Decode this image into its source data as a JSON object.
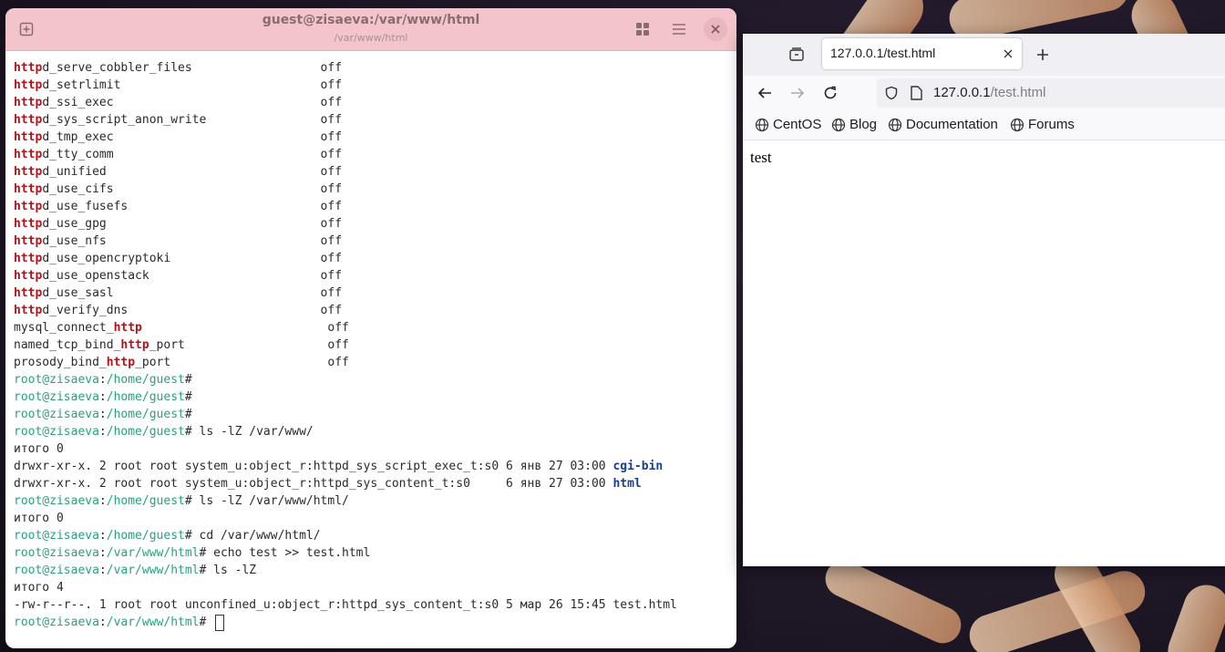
{
  "terminal": {
    "title": "guest@zisaeva:/var/www/html",
    "subtitle": "/var/www/html",
    "lines": [
      {
        "segs": [
          [
            "h",
            "http"
          ],
          [
            "t",
            "d_serve_cobbler_files                  off"
          ]
        ]
      },
      {
        "segs": [
          [
            "h",
            "http"
          ],
          [
            "t",
            "d_setrlimit                            off"
          ]
        ]
      },
      {
        "segs": [
          [
            "h",
            "http"
          ],
          [
            "t",
            "d_ssi_exec                             off"
          ]
        ]
      },
      {
        "segs": [
          [
            "h",
            "http"
          ],
          [
            "t",
            "d_sys_script_anon_write                off"
          ]
        ]
      },
      {
        "segs": [
          [
            "h",
            "http"
          ],
          [
            "t",
            "d_tmp_exec                             off"
          ]
        ]
      },
      {
        "segs": [
          [
            "h",
            "http"
          ],
          [
            "t",
            "d_tty_comm                             off"
          ]
        ]
      },
      {
        "segs": [
          [
            "h",
            "http"
          ],
          [
            "t",
            "d_unified                              off"
          ]
        ]
      },
      {
        "segs": [
          [
            "h",
            "http"
          ],
          [
            "t",
            "d_use_cifs                             off"
          ]
        ]
      },
      {
        "segs": [
          [
            "h",
            "http"
          ],
          [
            "t",
            "d_use_fusefs                           off"
          ]
        ]
      },
      {
        "segs": [
          [
            "h",
            "http"
          ],
          [
            "t",
            "d_use_gpg                              off"
          ]
        ]
      },
      {
        "segs": [
          [
            "h",
            "http"
          ],
          [
            "t",
            "d_use_nfs                              off"
          ]
        ]
      },
      {
        "segs": [
          [
            "h",
            "http"
          ],
          [
            "t",
            "d_use_opencryptoki                     off"
          ]
        ]
      },
      {
        "segs": [
          [
            "h",
            "http"
          ],
          [
            "t",
            "d_use_openstack                        off"
          ]
        ]
      },
      {
        "segs": [
          [
            "h",
            "http"
          ],
          [
            "t",
            "d_use_sasl                             off"
          ]
        ]
      },
      {
        "segs": [
          [
            "h",
            "http"
          ],
          [
            "t",
            "d_verify_dns                           off"
          ]
        ]
      },
      {
        "segs": [
          [
            "t",
            "mysql_connect_"
          ],
          [
            "h",
            "http"
          ],
          [
            "t",
            "                          off"
          ]
        ]
      },
      {
        "segs": [
          [
            "t",
            "named_tcp_bind_"
          ],
          [
            "h",
            "http"
          ],
          [
            "t",
            "_port                    off"
          ]
        ]
      },
      {
        "segs": [
          [
            "t",
            "prosody_bind_"
          ],
          [
            "h",
            "http"
          ],
          [
            "t",
            "_port                      off"
          ]
        ]
      },
      {
        "segs": [
          [
            "p",
            "root@zisaeva"
          ],
          [
            "t",
            ":"
          ],
          [
            "p",
            "/home/guest"
          ],
          [
            "t",
            "#"
          ]
        ]
      },
      {
        "segs": [
          [
            "p",
            "root@zisaeva"
          ],
          [
            "t",
            ":"
          ],
          [
            "p",
            "/home/guest"
          ],
          [
            "t",
            "#"
          ]
        ]
      },
      {
        "segs": [
          [
            "p",
            "root@zisaeva"
          ],
          [
            "t",
            ":"
          ],
          [
            "p",
            "/home/guest"
          ],
          [
            "t",
            "#"
          ]
        ]
      },
      {
        "segs": [
          [
            "p",
            "root@zisaeva"
          ],
          [
            "t",
            ":"
          ],
          [
            "p",
            "/home/guest"
          ],
          [
            "t",
            "# ls -lZ /var/www/"
          ]
        ]
      },
      {
        "segs": [
          [
            "t",
            "итого 0"
          ]
        ]
      },
      {
        "segs": [
          [
            "t",
            "drwxr-xr-x. 2 root root system_u:object_r:httpd_sys_script_exec_t:s0 6 янв 27 03:00 "
          ],
          [
            "d",
            "cgi-bin"
          ]
        ]
      },
      {
        "segs": [
          [
            "t",
            "drwxr-xr-x. 2 root root system_u:object_r:httpd_sys_content_t:s0     6 янв 27 03:00 "
          ],
          [
            "d",
            "html"
          ]
        ]
      },
      {
        "segs": [
          [
            "p",
            "root@zisaeva"
          ],
          [
            "t",
            ":"
          ],
          [
            "p",
            "/home/guest"
          ],
          [
            "t",
            "# ls -lZ /var/www/html/"
          ]
        ]
      },
      {
        "segs": [
          [
            "t",
            "итого 0"
          ]
        ]
      },
      {
        "segs": [
          [
            "p",
            "root@zisaeva"
          ],
          [
            "t",
            ":"
          ],
          [
            "p",
            "/home/guest"
          ],
          [
            "t",
            "# cd /var/www/html/"
          ]
        ]
      },
      {
        "segs": [
          [
            "p",
            "root@zisaeva"
          ],
          [
            "t",
            ":"
          ],
          [
            "p",
            "/var/www/html"
          ],
          [
            "t",
            "# echo test >> test.html"
          ]
        ]
      },
      {
        "segs": [
          [
            "p",
            "root@zisaeva"
          ],
          [
            "t",
            ":"
          ],
          [
            "p",
            "/var/www/html"
          ],
          [
            "t",
            "# ls -lZ"
          ]
        ]
      },
      {
        "segs": [
          [
            "t",
            "итого 4"
          ]
        ]
      },
      {
        "segs": [
          [
            "t",
            "-rw-r--r--. 1 root root unconfined_u:object_r:httpd_sys_content_t:s0 5 мар 26 15:45 test.html"
          ]
        ]
      },
      {
        "segs": [
          [
            "p",
            "root@zisaeva"
          ],
          [
            "t",
            ":"
          ],
          [
            "p",
            "/var/www/html"
          ],
          [
            "t",
            "# "
          ],
          [
            "c",
            ""
          ]
        ]
      }
    ],
    "colors": {
      "highlight": "#b3141c",
      "prompt": "#27a37a",
      "directory": "#173e93",
      "header": "#f3c5cb"
    }
  },
  "browser": {
    "tab_label": "127.0.0.1/test.html",
    "url_host": "127.0.0.1",
    "url_path": "/test.html",
    "bookmarks": [
      "CentOS",
      "Blog",
      "Documentation",
      "Forums"
    ],
    "page_text": "test"
  },
  "icons": [
    "new-tab-icon",
    "grid-icon",
    "hamburger-menu-icon",
    "close-icon",
    "tab-list-icon",
    "plus-icon",
    "back-arrow-icon",
    "forward-arrow-icon",
    "reload-icon",
    "shield-icon",
    "page-icon",
    "globe-icon"
  ]
}
